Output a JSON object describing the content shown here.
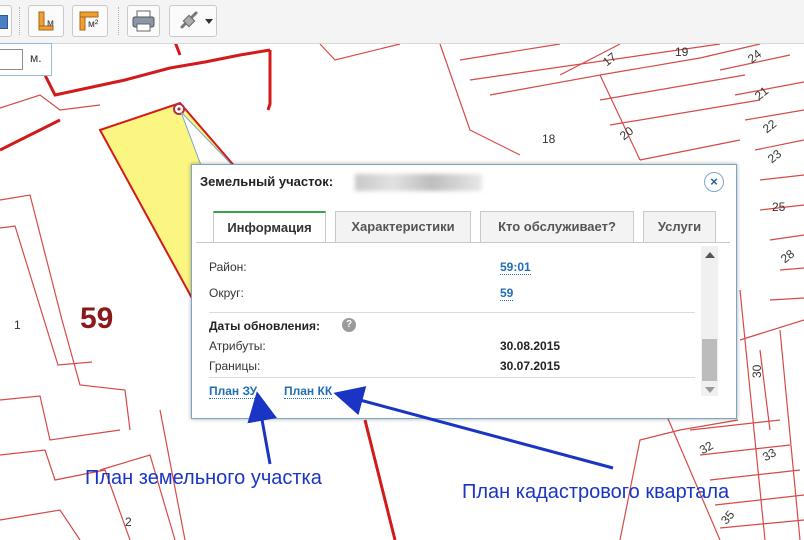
{
  "toolbar": {
    "buttons": [
      {
        "name": "map-tool-icon"
      },
      {
        "name": "measure-length-icon",
        "label": "м"
      },
      {
        "name": "measure-area-icon",
        "label": "м²"
      },
      {
        "name": "print-icon"
      },
      {
        "name": "link-icon"
      }
    ]
  },
  "measure": {
    "input_value": "",
    "unit": "м."
  },
  "map": {
    "big_label": "59",
    "labels": [
      "17",
      "19",
      "18",
      "20",
      "21",
      "22",
      "23",
      "24",
      "25",
      "28",
      "30",
      "32",
      "33",
      "35",
      "1",
      "2"
    ],
    "colors": {
      "boundary": "#d31a1a",
      "thin_boundary": "#d64a4a",
      "parcel_fill": "#fbf582",
      "marker": "#b0304a"
    }
  },
  "popup": {
    "title": "Земельный участок:",
    "close_label": "×",
    "tabs": [
      {
        "label": "Информация",
        "active": true
      },
      {
        "label": "Характеристики",
        "active": false
      },
      {
        "label": "Кто обслуживает?",
        "active": false
      },
      {
        "label": "Услуги",
        "active": false
      }
    ],
    "rows": [
      {
        "label": "Район:",
        "value": "59:01"
      },
      {
        "label": "Округ:",
        "value": "59"
      }
    ],
    "dates": {
      "title": "Даты обновления:",
      "help_label": "?",
      "attributes_label": "Атрибуты:",
      "attributes_value": "30.08.2015",
      "borders_label": "Границы:",
      "borders_value": "30.07.2015"
    },
    "links": {
      "plan_zu": "План ЗУ",
      "plan_kk": "План КК"
    }
  },
  "annotations": {
    "parcel_plan": "План земельного участка",
    "quarter_plan": "План кадастрового квартала",
    "arrow_color": "#1a35c4"
  }
}
